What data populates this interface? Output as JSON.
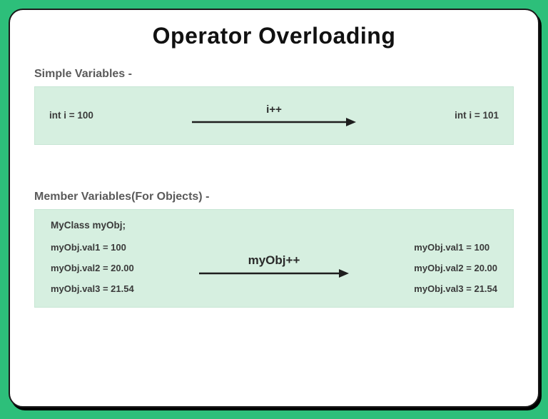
{
  "title": "Operator Overloading",
  "simple": {
    "label": "Simple Variables -",
    "before": "int i = 100",
    "op": "i++",
    "after": "int i = 101"
  },
  "member": {
    "label": "Member Variables(For Objects) -",
    "decl": "MyClass myObj;",
    "before": [
      "myObj.val1 = 100",
      "myObj.val2 = 20.00",
      "myObj.val3 = 21.54"
    ],
    "op": "myObj++",
    "after": [
      "myObj.val1 = 100",
      "myObj.val2 = 20.00",
      "myObj.val3 = 21.54"
    ]
  }
}
